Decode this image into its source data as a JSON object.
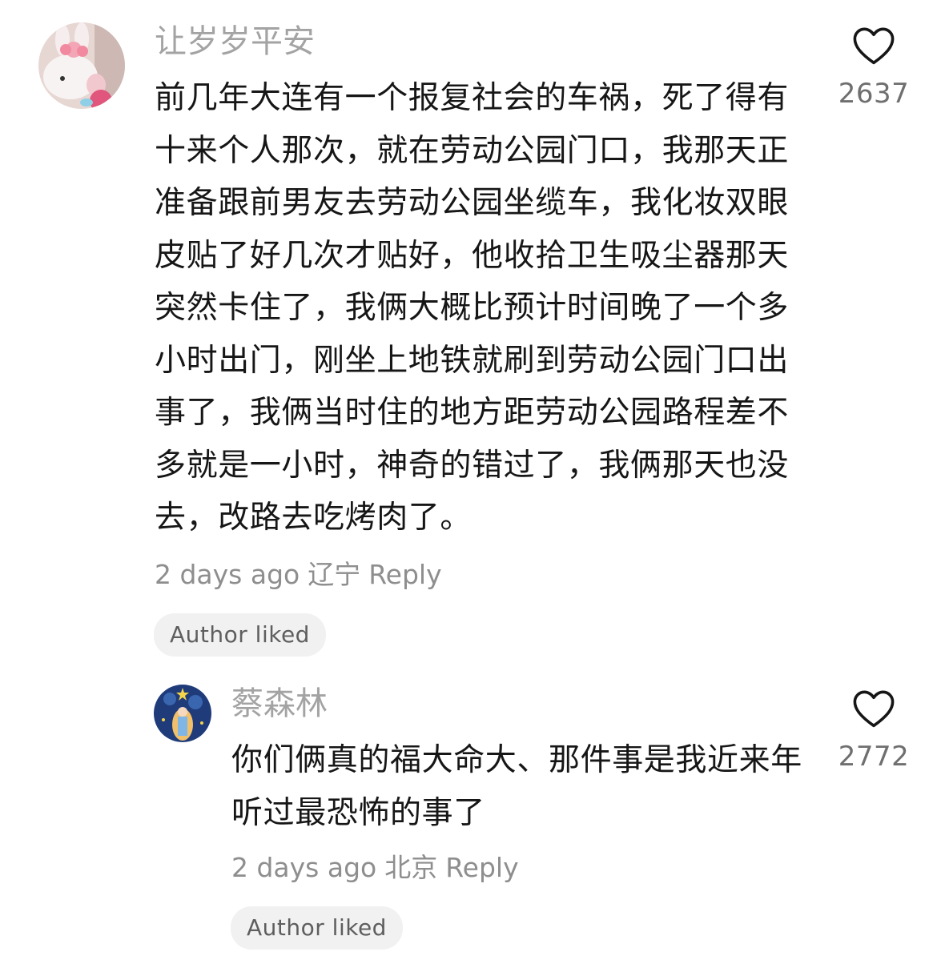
{
  "comments": [
    {
      "username": "让岁岁平安",
      "text": "前几年大连有一个报复社会的车祸，死了得有十来个人那次，就在劳动公园门口，我那天正准备跟前男友去劳动公园坐缆车，我化妆双眼皮贴了好几次才贴好，他收拾卫生吸尘器那天突然卡住了，我俩大概比预计时间晚了一个多小时出门，刚坐上地铁就刷到劳动公园门口出事了，我俩当时住的地方距劳动公园路程差不多就是一小时，神奇的错过了，我俩那天也没去，改路去吃烤肉了。",
      "time": "2 days ago",
      "location": "辽宁",
      "reply_label": "Reply",
      "author_liked": "Author liked",
      "likes": "2637"
    },
    {
      "username": "蔡森林",
      "text": "你们俩真的福大命大、那件事是我近来年听过最恐怖的事了",
      "time": "2 days ago",
      "location": "北京",
      "reply_label": "Reply",
      "author_liked": "Author liked",
      "likes": "2772"
    }
  ],
  "icons": {
    "like": "heart-outline-icon",
    "avatar1": "pink-plush-bunny-avatar",
    "avatar2": "starry-night-illustration-avatar"
  },
  "colors": {
    "username": "#a3a3a3",
    "text": "#161616",
    "meta": "#8e8e8e",
    "badge_bg": "#f1f1f1"
  }
}
